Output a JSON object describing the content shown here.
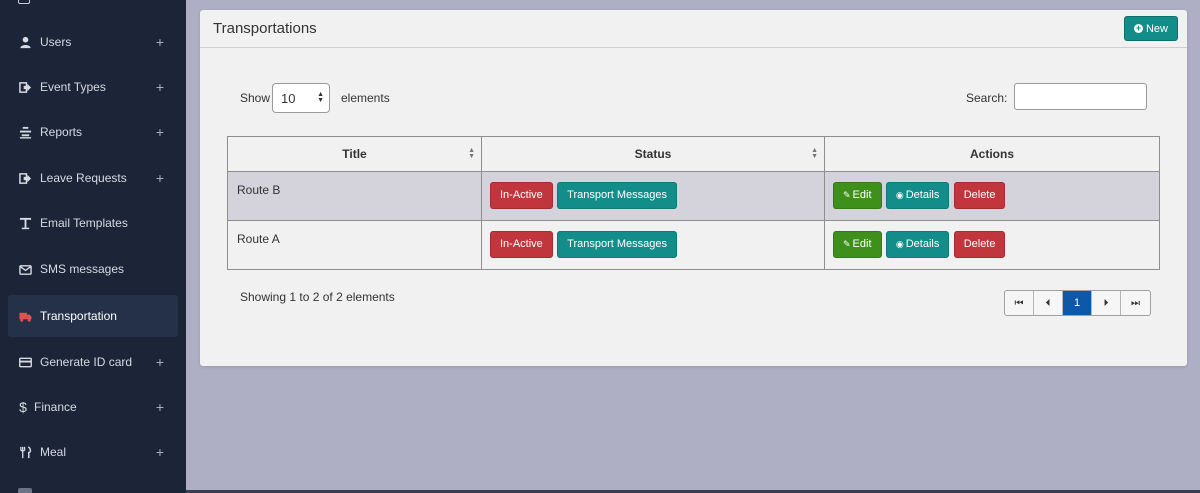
{
  "sidebar": {
    "items": [
      {
        "label": "Users",
        "icon": "user-icon",
        "has_plus": true
      },
      {
        "label": "Event Types",
        "icon": "sign-in-icon",
        "has_plus": true
      },
      {
        "label": "Reports",
        "icon": "reports-icon",
        "has_plus": true
      },
      {
        "label": "Leave Requests",
        "icon": "sign-in-icon",
        "has_plus": true
      },
      {
        "label": "Email Templates",
        "icon": "text-icon",
        "has_plus": false
      },
      {
        "label": "SMS messages",
        "icon": "envelope-icon",
        "has_plus": false
      },
      {
        "label": "Transportation",
        "icon": "truck-icon",
        "has_plus": false,
        "active": true
      },
      {
        "label": "Generate ID card",
        "icon": "credit-card-icon",
        "has_plus": true
      },
      {
        "label": "Finance",
        "icon": "dollar-icon",
        "has_plus": true
      },
      {
        "label": "Meal",
        "icon": "cutlery-icon",
        "has_plus": true
      }
    ],
    "plus_symbol": "+"
  },
  "panel": {
    "title": "Transportations",
    "new_button": "New"
  },
  "controls": {
    "show_label": "Show",
    "page_size": "10",
    "elements_label": "elements",
    "search_label": "Search:",
    "search_value": ""
  },
  "table": {
    "headers": [
      "Title",
      "Status",
      "Actions"
    ],
    "rows": [
      {
        "title": "Route B",
        "status": "In-Active",
        "messages": "Transport Messages",
        "edit": "Edit",
        "details": "Details",
        "delete": "Delete"
      },
      {
        "title": "Route A",
        "status": "In-Active",
        "messages": "Transport Messages",
        "edit": "Edit",
        "details": "Details",
        "delete": "Delete"
      }
    ]
  },
  "footer": {
    "info": "Showing 1 to 2 of 2 elements",
    "current_page": "1"
  },
  "colors": {
    "sidebar_bg": "#1b2537",
    "teal": "#138d8a",
    "red": "#c0363c",
    "green": "#3f8f1b",
    "page_active": "#0e58a8",
    "truck_icon": "#e0524f"
  }
}
